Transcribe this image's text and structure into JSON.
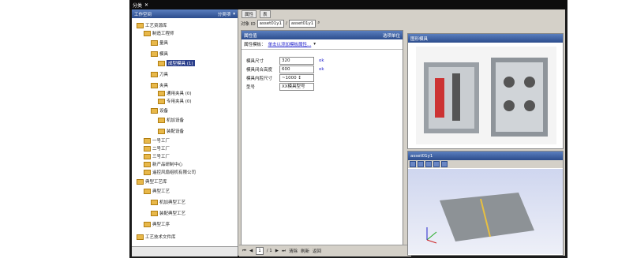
{
  "window": {
    "title": "分类",
    "close_glyph": "✕"
  },
  "left_panel": {
    "title": "工作空间",
    "dropdown_label": "分类项",
    "tree": [
      {
        "label": "工艺资源库",
        "level": 0,
        "icon": "red-db-icon"
      },
      {
        "label": "制造工程师",
        "level": 1,
        "icon": "gear-icon"
      },
      {
        "label": "量具",
        "level": 2,
        "icon": "gauge-icon"
      },
      {
        "label": "模具",
        "level": 2,
        "icon": "mold-icon"
      },
      {
        "label": "成型模具 (1)",
        "level": 3,
        "icon": "mold-item-icon",
        "selected": true
      },
      {
        "label": "刀具",
        "level": 2,
        "icon": "cutter-icon"
      },
      {
        "label": "夹具",
        "level": 2,
        "icon": "fixture-icon"
      },
      {
        "label": "通用夹具 (0)",
        "level": 3,
        "icon": "fixture-item-icon"
      },
      {
        "label": "专用夹具 (0)",
        "level": 3,
        "icon": "fixture-item-icon"
      },
      {
        "label": "设备",
        "level": 2,
        "icon": "equipment-icon"
      },
      {
        "label": "机加设备",
        "level": 3,
        "icon": "machine-icon"
      },
      {
        "label": "装配设备",
        "level": 3,
        "icon": "assembly-icon"
      },
      {
        "label": "一号工厂",
        "level": 1,
        "icon": "factory-icon"
      },
      {
        "label": "二号工厂",
        "level": 1,
        "icon": "factory-icon"
      },
      {
        "label": "三号工厂",
        "level": 1,
        "icon": "factory-icon"
      },
      {
        "label": "新产品研制中心",
        "level": 1,
        "icon": "factory-icon"
      },
      {
        "label": "遥控风扇组机有限公司",
        "level": 1,
        "icon": "factory-icon"
      },
      {
        "label": "典型工艺库",
        "level": 0,
        "icon": "typical-db-icon"
      },
      {
        "label": "典型工艺",
        "level": 1,
        "icon": "process-icon"
      },
      {
        "label": "机加典型工艺",
        "level": 2,
        "icon": "process-item-icon"
      },
      {
        "label": "装配典型工艺",
        "level": 2,
        "icon": "process-item-icon"
      },
      {
        "label": "典型工序",
        "level": 1,
        "icon": "operation-icon"
      },
      {
        "label": "工艺技术文件库",
        "level": 0,
        "icon": "folder-icon"
      }
    ]
  },
  "middle_panel": {
    "tabs": [
      "属性",
      "表"
    ],
    "query": {
      "label": "对象 ID",
      "id_value": "asset01y1",
      "sep": "/",
      "right_value": "asset01y1"
    },
    "header": {
      "title": "属性值",
      "mode": "选项单位"
    },
    "template": {
      "label": "属性模板：",
      "link": "单击以添加模板属性..."
    },
    "properties": [
      {
        "label": "模具尺寸",
        "value": "320",
        "link": "ok"
      },
      {
        "label": "模具闭合高度",
        "value": "600",
        "link": "ok"
      },
      {
        "label": "模具内腔尺寸",
        "value": "~1000 ↕",
        "link": ""
      },
      {
        "label": "型号",
        "value": "XX模具型号",
        "link": ""
      }
    ],
    "footer": {
      "page": "1",
      "page_total": "/ 1",
      "btn1": "清除",
      "btn2": "刷新",
      "btn3": "返回"
    }
  },
  "right_panel": {
    "top_title": "图形模具",
    "bottom_title": "asset01y1"
  }
}
